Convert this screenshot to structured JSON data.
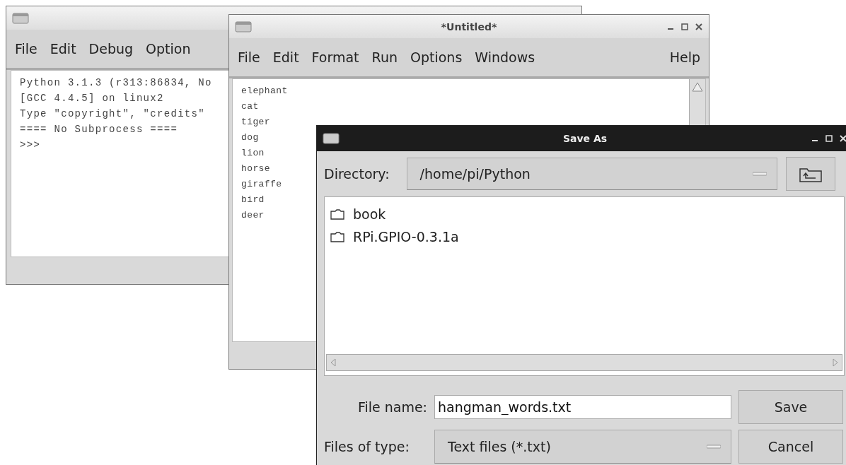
{
  "shell_window": {
    "menu": [
      "File",
      "Edit",
      "Debug",
      "Option"
    ],
    "lines": [
      "Python 3.1.3 (r313:86834, No",
      "[GCC 4.4.5] on linux2",
      "Type \"copyright\", \"credits\"",
      "==== No Subprocess ====",
      ">>>"
    ]
  },
  "editor_window": {
    "title": "*Untitled*",
    "menu": [
      "File",
      "Edit",
      "Format",
      "Run",
      "Options",
      "Windows"
    ],
    "help_menu": "Help",
    "lines": [
      "elephant",
      "cat",
      "tiger",
      "dog",
      "lion",
      "horse",
      "giraffe",
      "bird",
      "deer"
    ]
  },
  "save_dialog": {
    "title": "Save As",
    "directory_label": "Directory:",
    "directory": "/home/pi/Python",
    "folders": [
      "book",
      "RPi.GPIO-0.3.1a"
    ],
    "file_name_label": "File name:",
    "file_name": "hangman_words.txt",
    "file_type_label": "Files of type:",
    "file_type": "Text files (*.txt)",
    "buttons": [
      "Save",
      "Cancel"
    ]
  }
}
